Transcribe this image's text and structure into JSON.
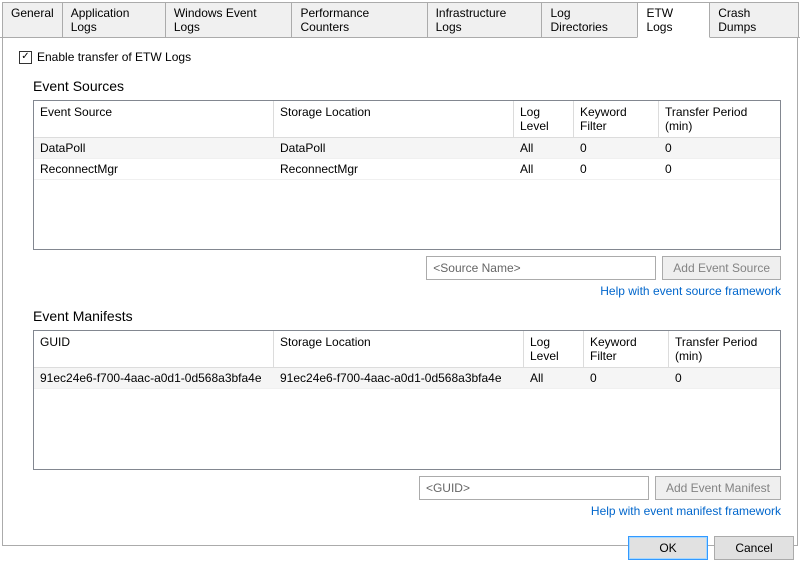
{
  "tabs": [
    {
      "label": "General"
    },
    {
      "label": "Application Logs"
    },
    {
      "label": "Windows Event Logs"
    },
    {
      "label": "Performance Counters"
    },
    {
      "label": "Infrastructure Logs"
    },
    {
      "label": "Log Directories"
    },
    {
      "label": "ETW Logs"
    },
    {
      "label": "Crash Dumps"
    }
  ],
  "enable_checkbox_label": "Enable transfer of ETW Logs",
  "sources": {
    "title": "Event Sources",
    "headers": {
      "c1": "Event Source",
      "c2": "Storage Location",
      "c3": "Log Level",
      "c4": "Keyword Filter",
      "c5": "Transfer Period (min)"
    },
    "rows": [
      {
        "c1": "DataPoll",
        "c2": "DataPoll",
        "c3": "All",
        "c4": "0",
        "c5": "0"
      },
      {
        "c1": "ReconnectMgr",
        "c2": "ReconnectMgr",
        "c3": "All",
        "c4": "0",
        "c5": "0"
      }
    ],
    "input_placeholder": "<Source Name>",
    "add_button": "Add Event Source",
    "help_link": "Help with event source framework"
  },
  "manifests": {
    "title": "Event Manifests",
    "headers": {
      "c1": "GUID",
      "c2": "Storage Location",
      "c3": "Log Level",
      "c4": "Keyword Filter",
      "c5": "Transfer Period (min)"
    },
    "rows": [
      {
        "c1": "91ec24e6-f700-4aac-a0d1-0d568a3bfa4e",
        "c2": "91ec24e6-f700-4aac-a0d1-0d568a3bfa4e",
        "c3": "All",
        "c4": "0",
        "c5": "0"
      }
    ],
    "input_placeholder": "<GUID>",
    "add_button": "Add Event Manifest",
    "help_link": "Help with event manifest framework"
  },
  "dialog": {
    "ok": "OK",
    "cancel": "Cancel"
  }
}
